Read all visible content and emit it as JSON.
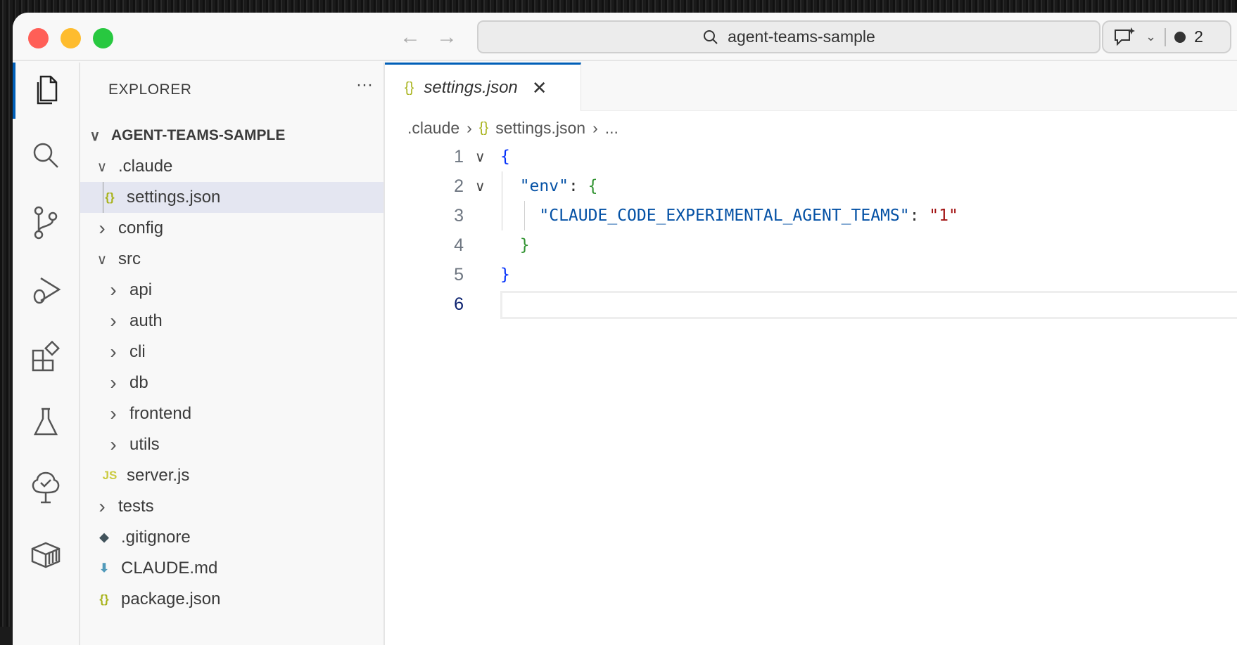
{
  "titlebar": {
    "search_text": "agent-teams-sample",
    "badge_count": "2"
  },
  "explorer": {
    "title": "EXPLORER",
    "more": "···",
    "root": "AGENT-TEAMS-SAMPLE",
    "items": [
      {
        "label": ".claude",
        "type": "folder",
        "open": true,
        "depth": 1
      },
      {
        "label": "settings.json",
        "type": "json",
        "depth": 2,
        "selected": true
      },
      {
        "label": "config",
        "type": "folder",
        "open": false,
        "depth": 1
      },
      {
        "label": "src",
        "type": "folder",
        "open": true,
        "depth": 1
      },
      {
        "label": "api",
        "type": "folder",
        "open": false,
        "depth": 2
      },
      {
        "label": "auth",
        "type": "folder",
        "open": false,
        "depth": 2
      },
      {
        "label": "cli",
        "type": "folder",
        "open": false,
        "depth": 2
      },
      {
        "label": "db",
        "type": "folder",
        "open": false,
        "depth": 2
      },
      {
        "label": "frontend",
        "type": "folder",
        "open": false,
        "depth": 2
      },
      {
        "label": "utils",
        "type": "folder",
        "open": false,
        "depth": 2
      },
      {
        "label": "server.js",
        "type": "js",
        "depth": 2
      },
      {
        "label": "tests",
        "type": "folder",
        "open": false,
        "depth": 1
      },
      {
        "label": ".gitignore",
        "type": "git",
        "depth": 1
      },
      {
        "label": "CLAUDE.md",
        "type": "md",
        "depth": 1
      },
      {
        "label": "package.json",
        "type": "json",
        "depth": 1
      }
    ]
  },
  "editor": {
    "tab_label": "settings.json",
    "breadcrumb": [
      ".claude",
      "settings.json",
      "..."
    ],
    "lines": [
      {
        "n": "1",
        "parts": [
          [
            "{",
            "#0431fa"
          ]
        ]
      },
      {
        "n": "2",
        "parts": [
          [
            "  ",
            ""
          ],
          [
            "\"env\"",
            "#0451a5"
          ],
          [
            ": ",
            "#333"
          ],
          [
            "{",
            "#319331"
          ]
        ]
      },
      {
        "n": "3",
        "parts": [
          [
            "    ",
            ""
          ],
          [
            "\"CLAUDE_CODE_EXPERIMENTAL_AGENT_TEAMS\"",
            "#0451a5"
          ],
          [
            ": ",
            "#333"
          ],
          [
            "\"1\"",
            "#a31515"
          ]
        ]
      },
      {
        "n": "4",
        "parts": [
          [
            "  ",
            ""
          ],
          [
            "}",
            "#319331"
          ]
        ]
      },
      {
        "n": "5",
        "parts": [
          [
            "}",
            "#0431fa"
          ]
        ]
      },
      {
        "n": "6",
        "parts": []
      }
    ]
  }
}
